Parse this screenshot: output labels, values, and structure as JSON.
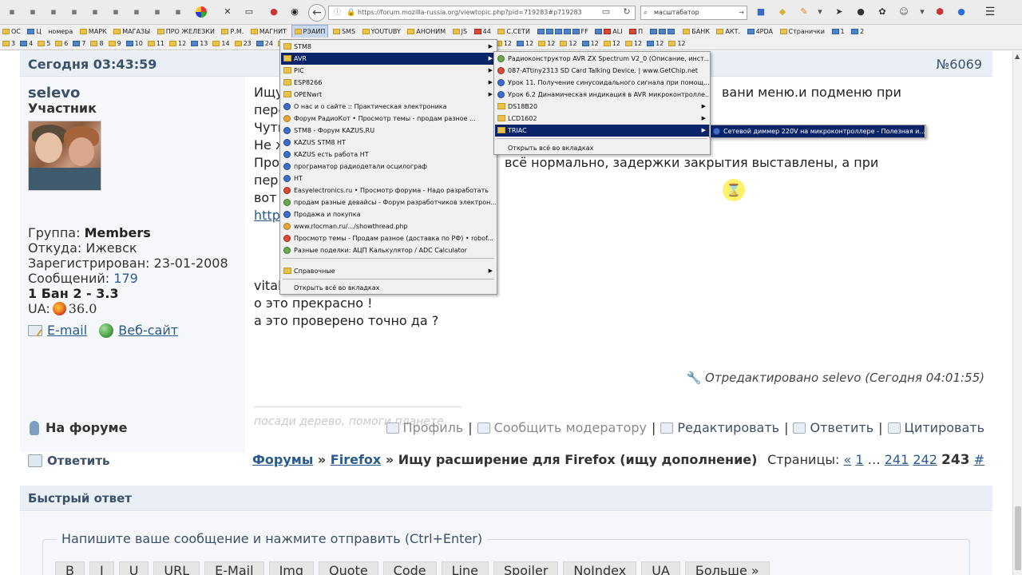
{
  "browser": {
    "url": "https://forum.mozilla-russia.org/viewtopic.php?pid=719283#p719283",
    "search_text": "масштабатор",
    "bookmarks_row1": [
      "ОС",
      "Ц",
      "номера",
      "МАРК",
      "МАГАЗЫ",
      "ПРО ЖЕЛЕЗКИ",
      "Р.М.",
      "МАГНИТ",
      "РЭАИП",
      "SMS",
      "YOUTUBY",
      "АНОНИМ",
      "JS",
      "44",
      "С.СЕТИ",
      "FF",
      "ALI",
      "П",
      "БАНК",
      "АКТ.",
      "4PDA",
      "Странички",
      "1",
      "2"
    ],
    "bookmarks_row2": [
      "3",
      "4",
      "5",
      "6",
      "7",
      "8",
      "9",
      "10",
      "11",
      "12",
      "13",
      "14",
      "23",
      "24",
      "25",
      "26",
      "27",
      "28",
      "29",
      "30",
      "12",
      "12",
      "12",
      "12",
      "12",
      "12",
      "12",
      "12",
      "12",
      "12",
      "12",
      "12",
      "12"
    ]
  },
  "post": {
    "time": "Сегодня 03:43:59",
    "number": "№6069",
    "author": "selevo",
    "author_title": "Участник",
    "group_label": "Группа:",
    "group_value": "Members",
    "from_label": "Откуда:",
    "from_value": "Ижевск",
    "registered_label": "Зарегистрирован:",
    "registered_value": "23-01-2008",
    "messages_label": "Сообщений:",
    "messages_value": "179",
    "ban_line": "1 Бан 2 - 3.3",
    "ua_label": "UA:",
    "ua_version": "36.0",
    "email_link": "E-mail",
    "website_link": "Веб-сайт",
    "lines": [
      "Ищу",
      "пере",
      "Чуть",
      "Не ж",
      "Про",
      " пер",
      "вот",
      "http"
    ],
    "line_right_1": "вани меню.и подменю при",
    "line_right_2": "всё нормально, задержки закрытия выставлены, а при",
    "vital": "vital",
    "line_ok": "о это  прекрасно !",
    "line_check": "а это проверено точно да ?",
    "edited": "Отредактировано selevo (Сегодня 04:01:55)",
    "signature": "посади дерево, помоги планете.",
    "on_forum": "На форуме",
    "actions": {
      "profile": "Профиль",
      "report": "Сообщить модератору",
      "edit": "Редактировать",
      "reply": "Ответить",
      "quote": "Цитировать"
    }
  },
  "nav": {
    "reply": "Ответить",
    "forums": "Форумы",
    "firefox": "Firefox",
    "sep": "»",
    "topic": "Ищу расширение для Firefox (ищу дополнение)",
    "pages_label": "Страницы:",
    "prev": "«",
    "p1": "1",
    "ellipsis": "…",
    "p241": "241",
    "p242": "242",
    "p243": "243",
    "hash": "#"
  },
  "quick_reply": {
    "title": "Быстрый ответ",
    "legend": "Напишите ваше сообщение и нажмите отправить (Ctrl+Enter)",
    "buttons": [
      "B",
      "I",
      "U",
      "URL",
      "E-Mail",
      "Img",
      "Quote",
      "Code",
      "Line",
      "Spoiler",
      "NoIndex",
      "UA",
      "Больше »"
    ]
  },
  "menu1": {
    "items": [
      "STM8",
      "AVR",
      "PIC",
      "ESP8266",
      "OPENwrt",
      "О нас и о сайте :: Практическая электроника",
      "Форум РадиоКот • Просмотр темы - продам разное ...",
      "STM8 - Форум KAZUS.RU",
      "KAZUS STM8 НТ",
      "KAZUS есть работа НТ",
      "програматор радиодетали осцилограф",
      "НТ",
      "Easyelectronics.ru • Просмотр форума - Надо разработать",
      "продам разные девайсы - Форум разработчиков электрон...",
      "Продажа и покупка",
      "www.rlocman.ru/.../showthread.php",
      "Просмотр темы - Продам разное (доставка по РФ) • robof...",
      "Разные поделки: АЦП Калькулятор / ADC Calculator",
      "Справочные",
      "Открыть всё во вкладках"
    ]
  },
  "menu2": {
    "items": [
      "Радиоконструктор AVR ZX Spectrum V2_0 (Описание, инст...",
      "087-ATtiny2313 SD Card Talking Device. | www.GetChip.net",
      "Урок 11. Получение синусоидального сигнала при помощ...",
      "Урок 6.2 Динамическая индикация в AVR микроконтролле...",
      "DS18B20",
      "LCD1602",
      "TRIAC",
      "Открыть всё во вкладках"
    ]
  },
  "menu3": {
    "items": [
      "Сетевой диммер 220V на микроконтроллере - Полезная и..."
    ]
  }
}
